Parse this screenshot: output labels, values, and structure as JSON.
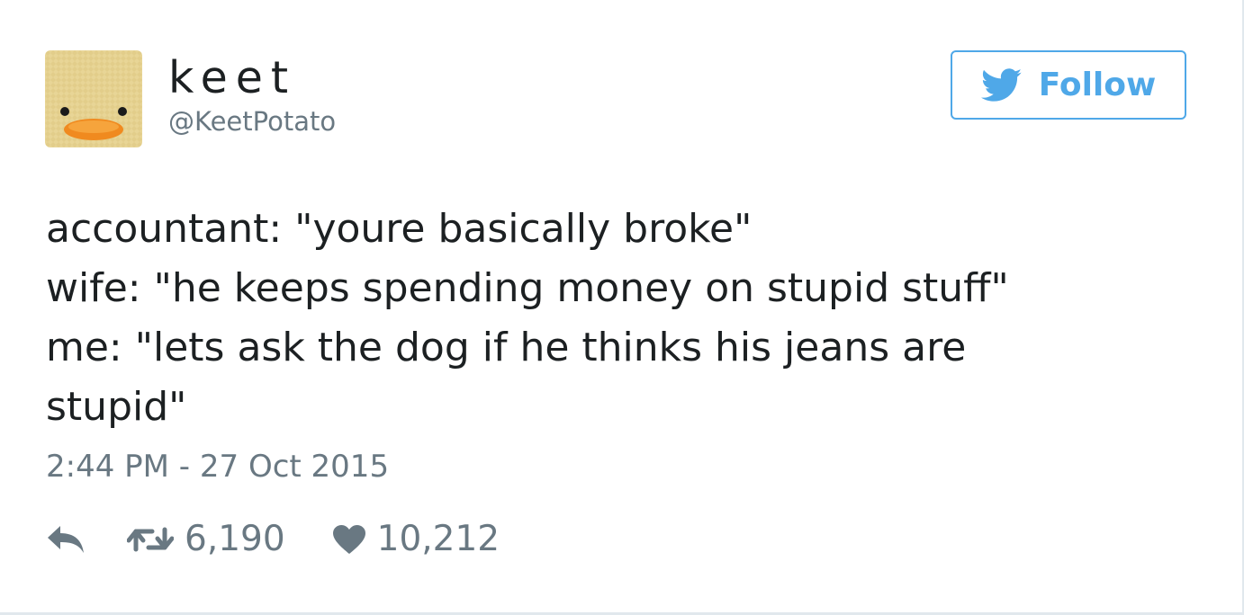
{
  "user": {
    "display_name": "keet",
    "handle": "@KeetPotato",
    "avatar_icon": "duck-face-avatar"
  },
  "follow_button": {
    "label": "Follow",
    "icon": "twitter-bird-icon",
    "color": "#4fa8e8"
  },
  "tweet": {
    "lines": [
      "accountant: \"youre basically broke\"",
      "wife: \"he keeps spending money on stupid stuff\"",
      "me: \"lets ask the dog if he thinks his jeans are",
      "stupid\""
    ],
    "timestamp": "2:44 PM - 27 Oct 2015"
  },
  "actions": {
    "reply": {
      "icon": "reply-icon"
    },
    "retweet": {
      "icon": "retweet-icon",
      "count": "6,190"
    },
    "like": {
      "icon": "heart-icon",
      "count": "10,212"
    }
  },
  "colors": {
    "text": "#1c2022",
    "muted": "#697882",
    "accent": "#4fa8e8"
  }
}
